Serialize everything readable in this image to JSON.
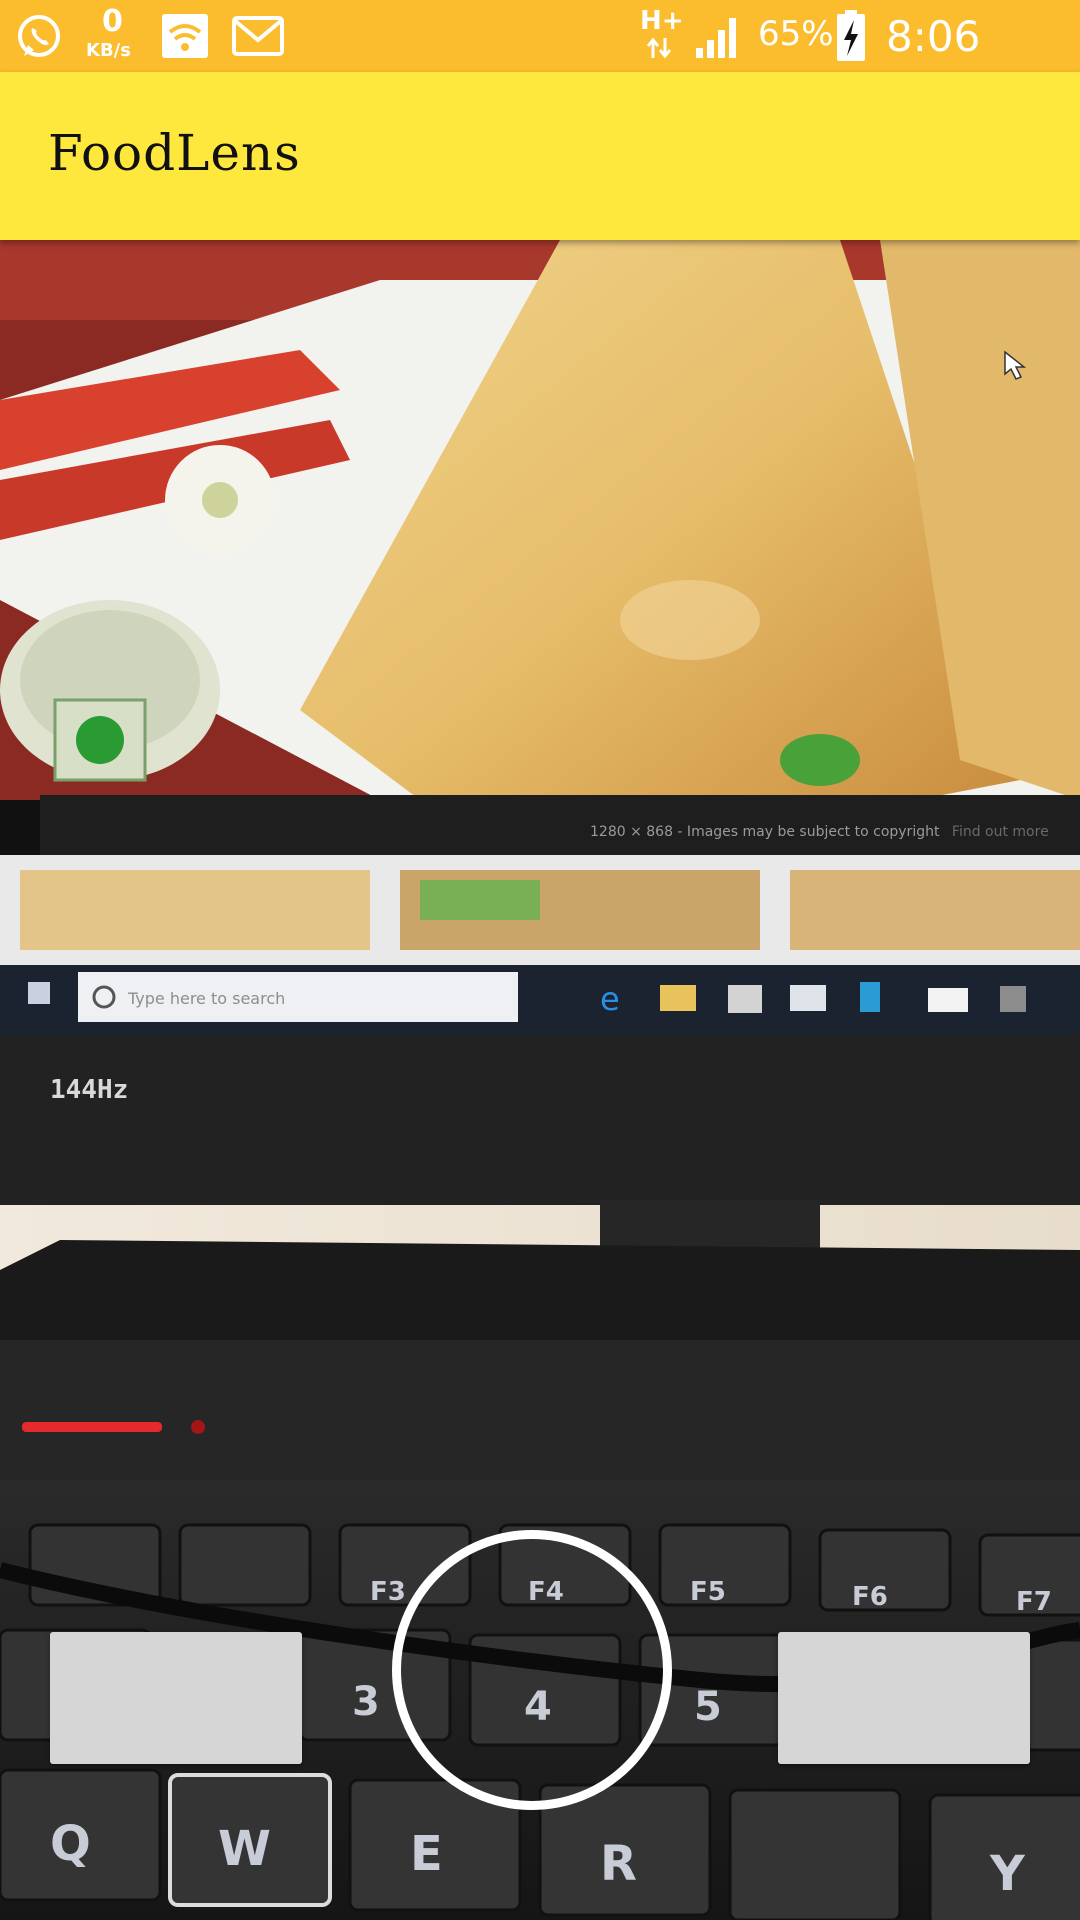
{
  "status_bar": {
    "data_speed_value": "0",
    "data_speed_unit": "KB/s",
    "network_type": "H+",
    "battery_percent": "65%",
    "time": "8:06 a.m.",
    "background_color": "#fbbd2e",
    "icons": [
      "whatsapp-icon",
      "wifi-icon",
      "gmail-icon",
      "data-arrows-icon",
      "signal-icon",
      "battery-charging-icon"
    ]
  },
  "app_bar": {
    "title": "FoodLens",
    "background_color": "#ffe83e"
  },
  "camera_preview": {
    "screen_caption": "1280 × 868 - Images may be subject to copyright",
    "screen_caption_link": "Find out more",
    "taskbar_search_placeholder": "Type here to search",
    "monitor_badge": "144Hz",
    "keyboard_keys": [
      "F3",
      "F4",
      "F5",
      "F6",
      "F7",
      "3",
      "4",
      "5",
      "Q",
      "W",
      "E",
      "R",
      "Y"
    ]
  },
  "controls": {
    "left_button_label": "",
    "right_button_label": "",
    "shutter_icon": "capture-ring-icon"
  }
}
